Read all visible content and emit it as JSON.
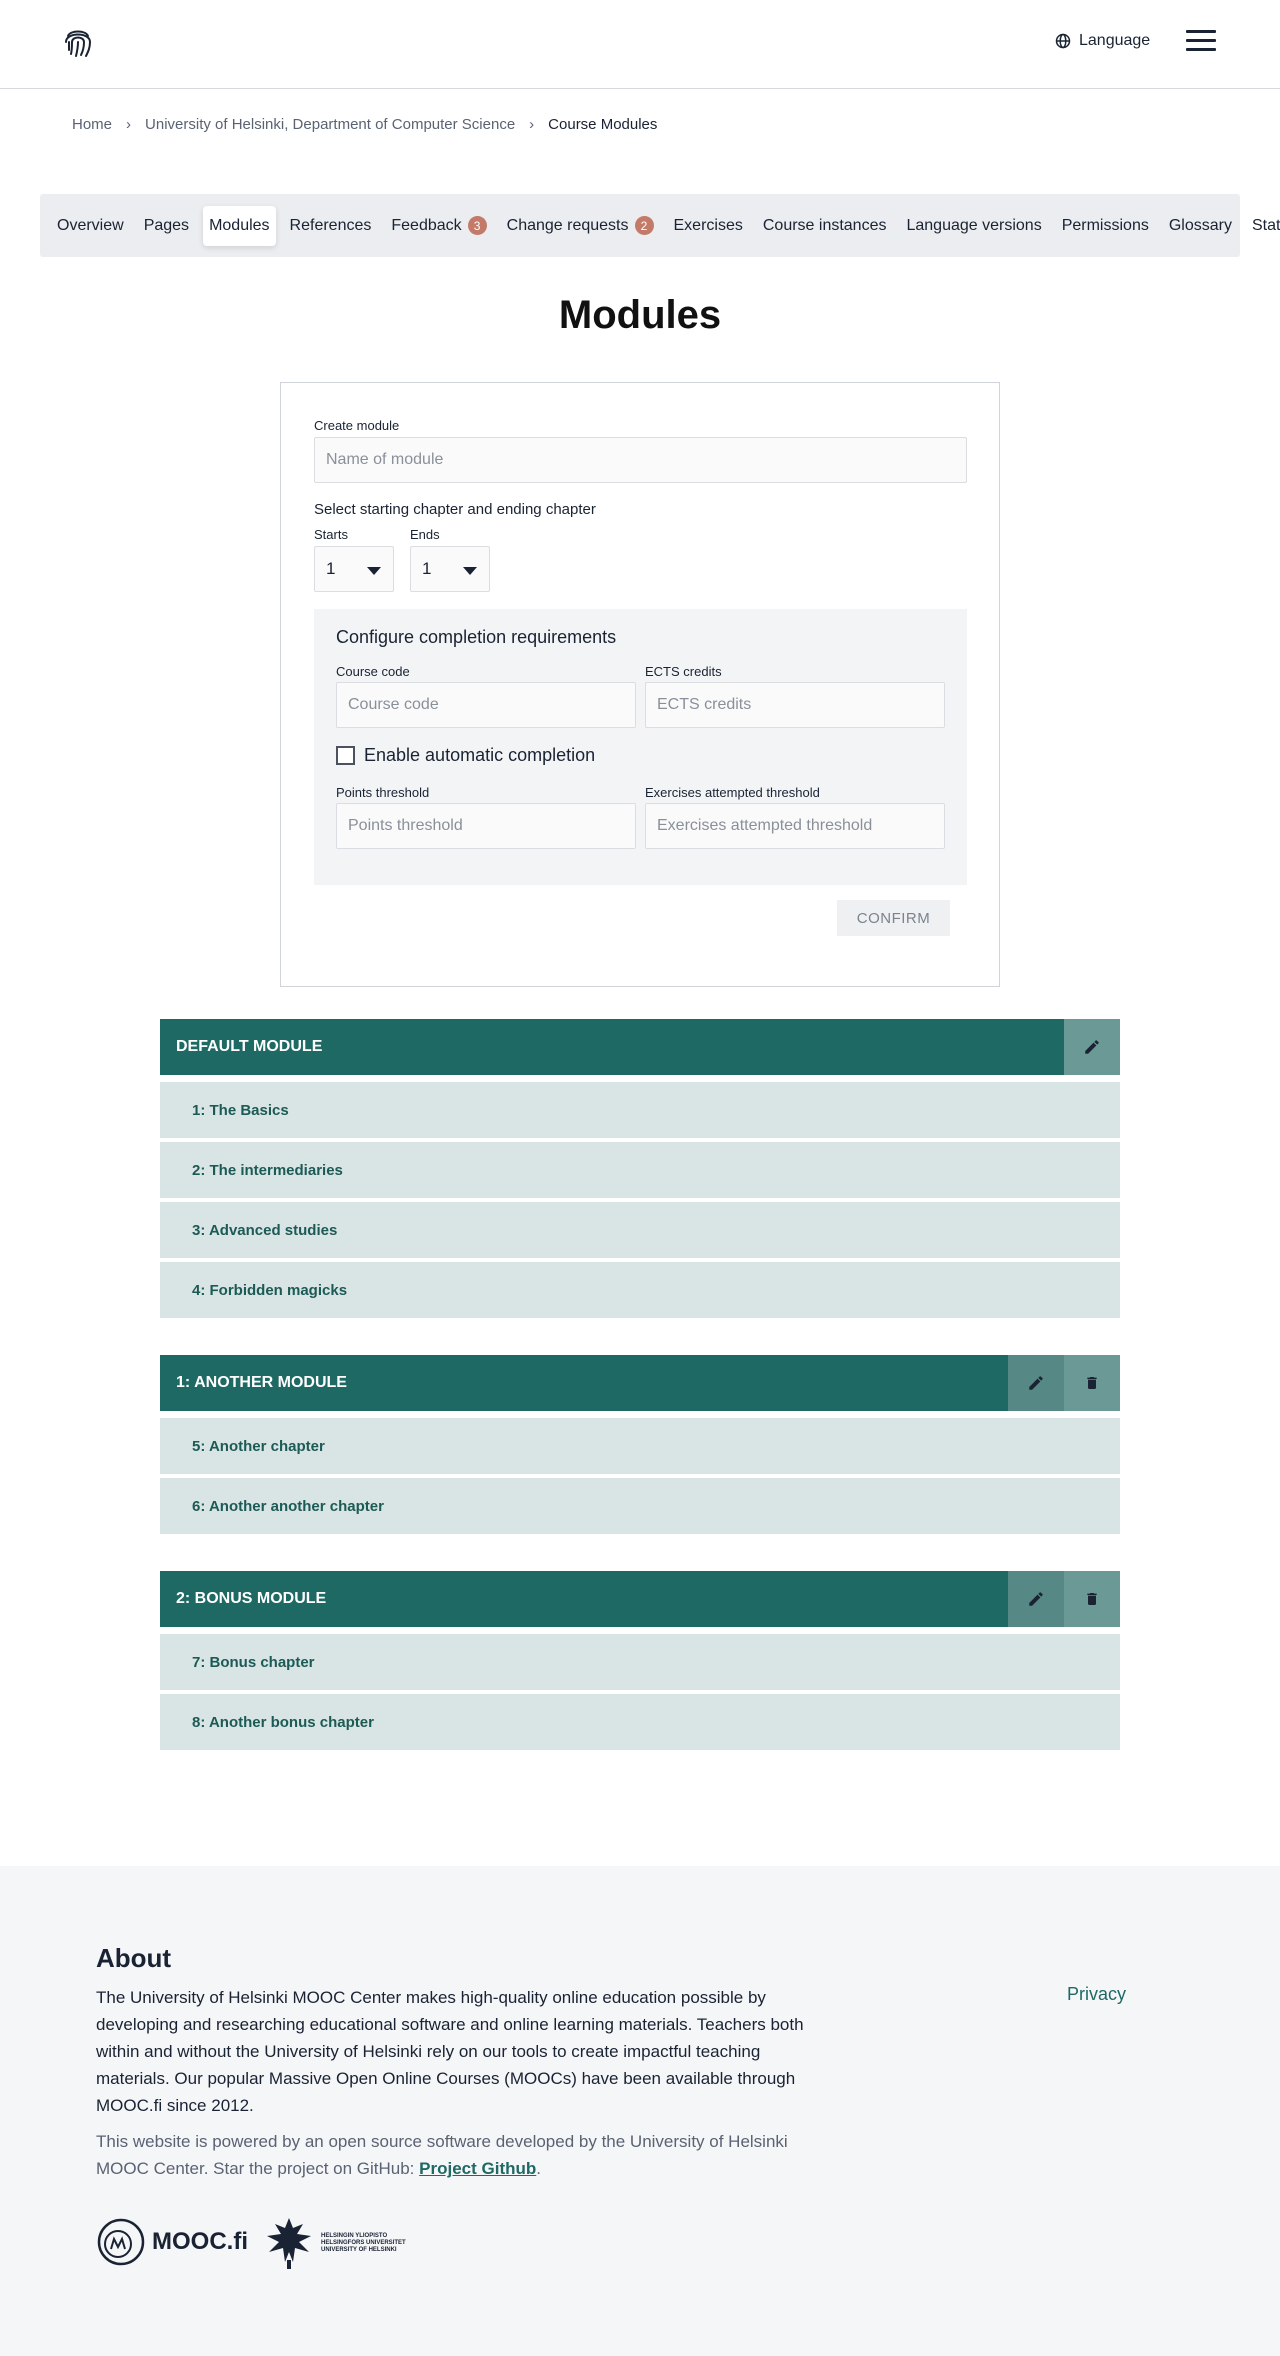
{
  "header": {
    "logo_icon": "fingerprint-icon",
    "language_label": "Language"
  },
  "breadcrumb": {
    "home": "Home",
    "org": "University of Helsinki, Department of Computer Science",
    "current": "Course Modules",
    "separator": "›"
  },
  "tabs": [
    {
      "label": "Overview"
    },
    {
      "label": "Pages"
    },
    {
      "label": "Modules",
      "active": true
    },
    {
      "label": "References"
    },
    {
      "label": "Feedback",
      "badge": "3"
    },
    {
      "label": "Change requests",
      "badge": "2"
    },
    {
      "label": "Exercises"
    },
    {
      "label": "Course instances"
    },
    {
      "label": "Language versions"
    },
    {
      "label": "Permissions"
    },
    {
      "label": "Glossary"
    },
    {
      "label": "Stats"
    }
  ],
  "page": {
    "title": "Modules"
  },
  "form": {
    "create_label": "Create module",
    "name_placeholder": "Name of module",
    "select_heading": "Select starting chapter and ending chapter",
    "starts_label": "Starts",
    "starts_value": "1",
    "ends_label": "Ends",
    "ends_value": "1",
    "completion_title": "Configure completion requirements",
    "course_code_label": "Course code",
    "course_code_placeholder": "Course code",
    "ects_label": "ECTS credits",
    "ects_placeholder": "ECTS credits",
    "auto_completion_label": "Enable automatic completion",
    "points_label": "Points threshold",
    "points_placeholder": "Points threshold",
    "exercises_label": "Exercises attempted threshold",
    "exercises_placeholder": "Exercises attempted threshold",
    "confirm_label": "CONFIRM"
  },
  "modules": {
    "default": {
      "title": "DEFAULT MODULE",
      "chapters": [
        "1: The Basics",
        "2: The intermediaries",
        "3: Advanced studies",
        "4: Forbidden magicks"
      ]
    },
    "another": {
      "title": "1: ANOTHER MODULE",
      "chapters": [
        "5: Another chapter",
        "6: Another another chapter"
      ]
    },
    "bonus": {
      "title": "2: BONUS MODULE",
      "chapters": [
        "7: Bonus chapter",
        "8: Another bonus chapter"
      ]
    }
  },
  "footer": {
    "about_title": "About",
    "about_text": "The University of Helsinki MOOC Center makes high-quality online education possible by developing and researching educational software and online learning materials. Teachers both within and without the University of Helsinki rely on our tools to create impactful teaching materials. Our popular Massive Open Online Courses (MOOCs) have been available through MOOC.fi since 2012.",
    "powered_text": "This website is powered by an open source software developed by the University of Helsinki MOOC Center. Star the project on GitHub:",
    "github_link": "Project Github",
    "period": ".",
    "privacy": "Privacy",
    "mooc_logo_text": "MOOC.fi",
    "hy_logo_lines": [
      "HELSINGIN YLIOPISTO",
      "HELSINGFORS UNIVERSITET",
      "UNIVERSITY OF HELSINKI"
    ]
  },
  "colors": {
    "module_header": "#1f6964",
    "chapter_bg": "#d9e5e4",
    "badge": "#c47a68"
  }
}
